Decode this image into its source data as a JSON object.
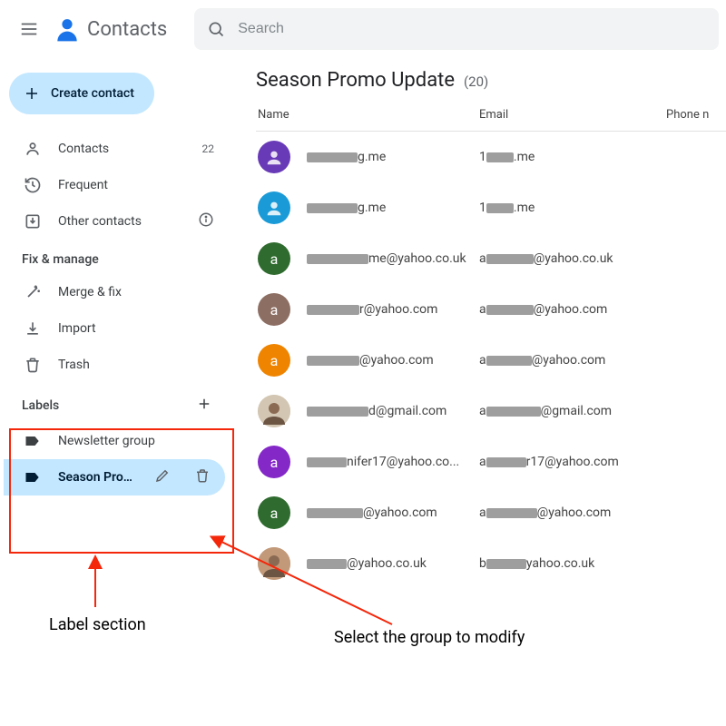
{
  "app": {
    "title": "Contacts"
  },
  "search": {
    "placeholder": "Search"
  },
  "create_button": {
    "label": "Create contact"
  },
  "nav": {
    "contacts": {
      "label": "Contacts",
      "count": "22"
    },
    "frequent": {
      "label": "Frequent"
    },
    "other": {
      "label": "Other contacts"
    }
  },
  "fix_manage": {
    "title": "Fix & manage",
    "merge": "Merge & fix",
    "import": "Import",
    "trash": "Trash"
  },
  "labels": {
    "title": "Labels",
    "items": [
      {
        "name": "Newsletter group",
        "selected": false
      },
      {
        "name": "Season Promo Update",
        "selected": true
      }
    ]
  },
  "main": {
    "title": "Season Promo Update",
    "count": "(20)",
    "columns": {
      "name": "Name",
      "email": "Email",
      "phone": "Phone n"
    },
    "rows": [
      {
        "avatar_color": "#683ab7",
        "avatar_letter": "",
        "profile": true,
        "name_blur_w": 56,
        "name_suffix": "g.me",
        "email_blur1_w": 22,
        "email_mid": "",
        "email_blur2_w": 30,
        "email_suffix": ".me"
      },
      {
        "avatar_color": "#1a9bd7",
        "avatar_letter": "",
        "profile": true,
        "name_blur_w": 56,
        "name_suffix": "g.me",
        "email_blur1_w": 22,
        "email_mid": "",
        "email_blur2_w": 30,
        "email_suffix": ".me"
      },
      {
        "avatar_color": "#2f6b2f",
        "avatar_letter": "a",
        "name_blur_w": 68,
        "name_suffix": "me@yahoo.co.uk",
        "email_blur1_w": 10,
        "email_mid": "",
        "email_blur2_w": 52,
        "email_suffix": "@yahoo.co.uk"
      },
      {
        "avatar_color": "#8d6e63",
        "avatar_letter": "a",
        "name_blur_w": 58,
        "name_suffix": "r@yahoo.com",
        "email_blur1_w": 10,
        "email_mid": "",
        "email_blur2_w": 52,
        "email_suffix": "@yahoo.com"
      },
      {
        "avatar_color": "#ef8400",
        "avatar_letter": "a",
        "name_blur_w": 58,
        "name_suffix": "@yahoo.com",
        "email_blur1_w": 10,
        "email_mid": "",
        "email_blur2_w": 50,
        "email_suffix": "@yahoo.com"
      },
      {
        "avatar_color": "#d3c7b4",
        "avatar_letter": "",
        "photo": true,
        "name_blur_w": 68,
        "name_suffix": "d@gmail.com",
        "email_blur1_w": 10,
        "email_mid": "",
        "email_blur2_w": 60,
        "email_suffix": "@gmail.com"
      },
      {
        "avatar_color": "#8428c8",
        "avatar_letter": "a",
        "name_blur_w": 44,
        "name_suffix": "nifer17@yahoo.co...",
        "email_blur1_w": 10,
        "email_mid": "",
        "email_blur2_w": 44,
        "email_suffix": "r17@yahoo.com"
      },
      {
        "avatar_color": "#2f6b2f",
        "avatar_letter": "a",
        "name_blur_w": 62,
        "name_suffix": "@yahoo.com",
        "email_blur1_w": 10,
        "email_mid": "",
        "email_blur2_w": 56,
        "email_suffix": "@yahoo.com"
      },
      {
        "avatar_color": "#c29a7a",
        "avatar_letter": "",
        "photo": true,
        "name_blur_w": 44,
        "name_suffix": "@yahoo.co.uk",
        "email_blur1_w": 10,
        "email_mid": "b",
        "email_blur2_w": 44,
        "email_suffix": "yahoo.co.uk"
      }
    ]
  },
  "annotations": {
    "label_section_text": "Label section",
    "select_group_text": "Select the group to modify"
  }
}
